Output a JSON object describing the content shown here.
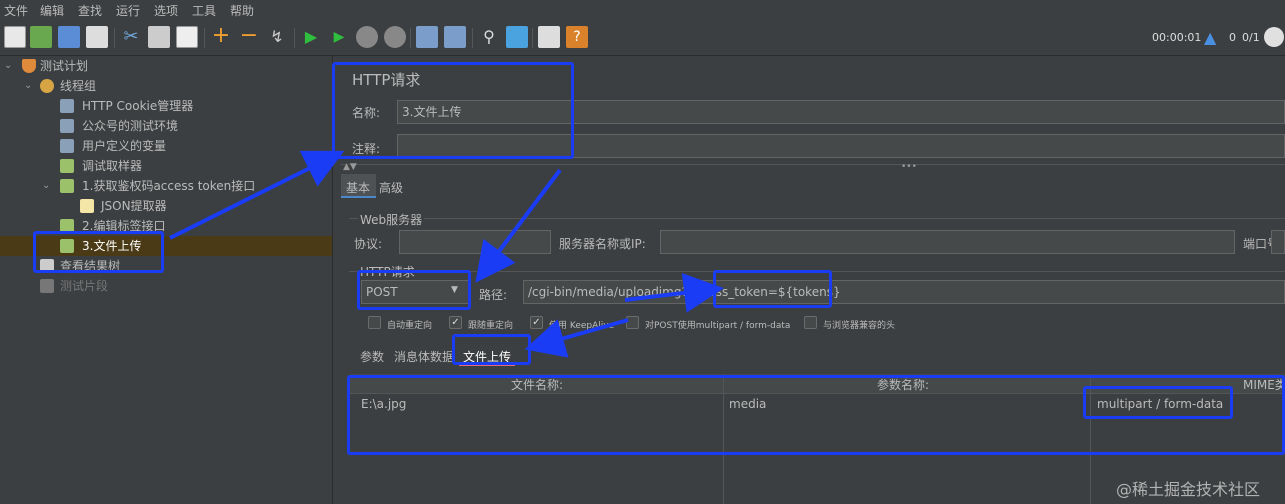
{
  "menu": [
    "文件",
    "编辑",
    "查找",
    "运行",
    "选项",
    "工具",
    "帮助"
  ],
  "toolbar": {
    "elapsed": "00:00:01",
    "warnings": "0",
    "threads": "0/1"
  },
  "tree": [
    {
      "label": "测试计划",
      "icon": "flask-icon"
    },
    {
      "label": "线程组",
      "icon": "gear-icon"
    },
    {
      "label": "HTTP Cookie管理器",
      "icon": "wrench-icon"
    },
    {
      "label": "公众号的测试环境",
      "icon": "wrench-icon"
    },
    {
      "label": "用户定义的变量",
      "icon": "wrench-icon"
    },
    {
      "label": "调试取样器",
      "icon": "pipette-icon"
    },
    {
      "label": "1.获取鉴权码access token接口",
      "icon": "pipette-icon"
    },
    {
      "label": "JSON提取器",
      "icon": "extractor-icon"
    },
    {
      "label": "2.编辑标签接口",
      "icon": "pipette-icon"
    },
    {
      "label": "3.文件上传",
      "icon": "pipette-icon"
    },
    {
      "label": "查看结果树",
      "icon": "chart-icon"
    },
    {
      "label": "测试片段",
      "icon": "fragment-icon"
    }
  ],
  "panel": {
    "title": "HTTP请求",
    "name_label": "名称:",
    "name_value": "3.文件上传",
    "comment_label": "注释:",
    "comment_value": "",
    "tabs": [
      "基本",
      "高级"
    ],
    "web_server_title": "Web服务器",
    "protocol_label": "协议:",
    "protocol_value": "",
    "server_label": "服务器名称或IP:",
    "server_value": "",
    "port_label": "端口号:",
    "http_request_title": "HTTP请求",
    "method": "POST",
    "path_label": "路径:",
    "path_value": "/cgi-bin/media/uploadimg?access_token=${tokens}",
    "checkboxes": [
      {
        "label": "自动重定向",
        "checked": false
      },
      {
        "label": "跟随重定向",
        "checked": true
      },
      {
        "label": "使用 KeepAlive",
        "checked": true
      },
      {
        "label": "对POST使用multipart / form-data",
        "checked": false
      },
      {
        "label": "与浏览器兼容的头",
        "checked": false
      }
    ],
    "subtabs": [
      "参数",
      "消息体数据",
      "文件上传"
    ],
    "table": {
      "headers": [
        "文件名称:",
        "参数名称:",
        "MIME类型:"
      ],
      "rows": [
        [
          "E:\\a.jpg",
          "media",
          "multipart / form-data"
        ]
      ]
    }
  },
  "watermark": "@稀土掘金技术社区",
  "colors": {
    "highlight": "#1a3cf5",
    "selected": "#4b3a16",
    "background": "#3c3f41"
  }
}
